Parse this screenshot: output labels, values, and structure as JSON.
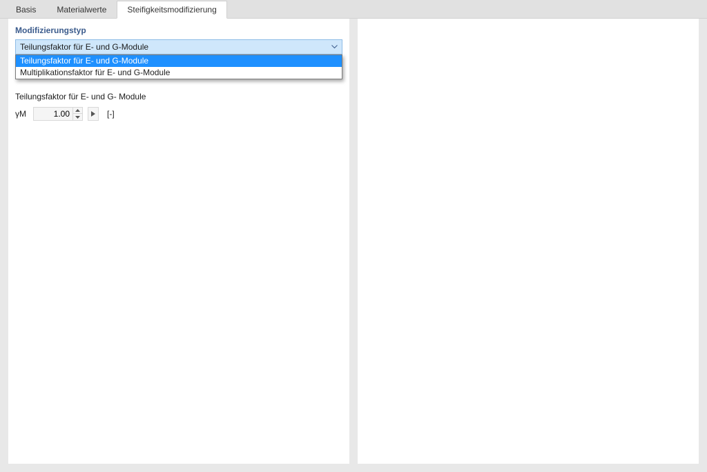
{
  "tabs": {
    "items": [
      {
        "label": "Basis"
      },
      {
        "label": "Materialwerte"
      },
      {
        "label": "Steifigkeitsmodifizierung"
      }
    ],
    "activeIndex": 2
  },
  "section": {
    "title": "Modifizierungstyp"
  },
  "combo": {
    "selected": "Teilungsfaktor für E- und G-Module",
    "options": [
      "Teilungsfaktor für E- und G-Module",
      "Multiplikationsfaktor für E- und G-Module"
    ],
    "highlightedIndex": 0
  },
  "field": {
    "label": "Teilungsfaktor für E- und G- Module",
    "symbol": "γM",
    "value": "1.00",
    "unit": "[-]"
  }
}
